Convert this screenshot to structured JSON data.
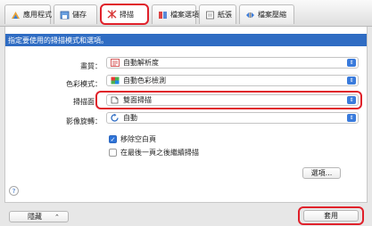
{
  "tabs": [
    {
      "label": "應用程式",
      "icon": "app-icon"
    },
    {
      "label": "儲存",
      "icon": "save-icon"
    },
    {
      "label": "掃描",
      "icon": "scan-icon"
    },
    {
      "label": "檔案選項",
      "icon": "file-options-icon"
    },
    {
      "label": "紙張",
      "icon": "paper-icon"
    },
    {
      "label": "檔案壓縮",
      "icon": "compression-icon"
    }
  ],
  "panel": {
    "title": "指定要使用的掃描模式和選項。",
    "fields": [
      {
        "label": "畫質：",
        "value": "自動解析度",
        "icon": "resolution-icon"
      },
      {
        "label": "色彩模式：",
        "value": "自動色彩檢測",
        "icon": "color-mode-icon"
      },
      {
        "label": "掃描面：",
        "value": "雙面掃描",
        "icon": "duplex-icon"
      },
      {
        "label": "影像旋轉：",
        "value": "自動",
        "icon": "rotate-icon"
      }
    ],
    "checkboxes": [
      {
        "label": "移除空白頁",
        "checked": true
      },
      {
        "label": "在最後一頁之後繼續掃描",
        "checked": false
      }
    ],
    "options_button": "選項...",
    "help": "?"
  },
  "footer": {
    "hide_label": "隱藏",
    "apply_label": "套用"
  },
  "colors": {
    "accent": "#2f6cc3",
    "highlight": "#e0202a"
  }
}
